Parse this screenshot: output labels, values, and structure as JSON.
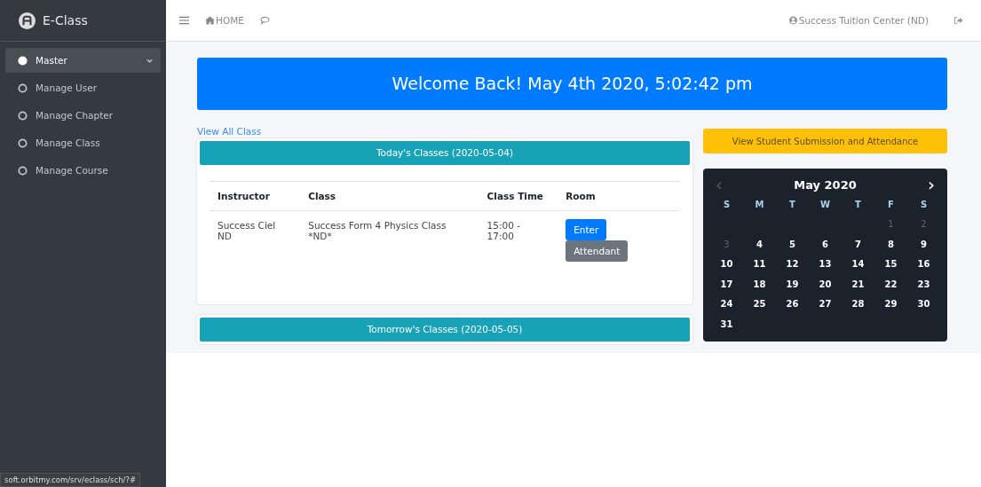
{
  "brand": {
    "name": "E-Class"
  },
  "sidebar": {
    "items": [
      {
        "kind": "group",
        "label": "Master",
        "selected": true,
        "expanded": true
      },
      {
        "kind": "link",
        "label": "Manage User",
        "selected": false
      },
      {
        "kind": "link",
        "label": "Manage Chapter",
        "selected": false
      },
      {
        "kind": "link",
        "label": "Manage Class",
        "selected": false
      },
      {
        "kind": "link",
        "label": "Manage Course",
        "selected": false
      }
    ]
  },
  "navbar": {
    "home": "HOME",
    "user": "Success Tuition Center (ND)"
  },
  "banner": {
    "text": "Welcome Back!  May 4th 2020, 5:02:42 pm"
  },
  "view_all_link": "View All Class",
  "today": {
    "title": "Today's Classes (2020-05-04)",
    "columns": [
      "Instructor",
      "Class",
      "Class Time",
      "Room"
    ],
    "rows": [
      {
        "instructor": "Success Ciel ND",
        "class": "Success Form 4 Physics Class *ND*",
        "time": "15:00 - 17:00",
        "buttons": [
          {
            "kind": "primary",
            "label": "Enter"
          },
          {
            "kind": "secondary",
            "label": "Attendant"
          }
        ]
      }
    ]
  },
  "tomorrow": {
    "title": "Tomorrow's Classes (2020-05-05)"
  },
  "submission_button": "View Student Submission and Attendance",
  "calendar": {
    "title": "May 2020",
    "prev": {
      "label": "‹",
      "disabled": true
    },
    "next": {
      "label": "›",
      "disabled": false
    },
    "weekdays": [
      "S",
      "M",
      "T",
      "W",
      "T",
      "F",
      "S"
    ],
    "weeks": [
      [
        {
          "day": "1",
          "muted": true
        },
        {
          "day": "2",
          "muted": true
        }
      ],
      [
        {
          "day": "3",
          "muted": true
        },
        {
          "day": "4",
          "muted": false
        },
        {
          "day": "5",
          "muted": false
        },
        {
          "day": "6",
          "muted": false
        },
        {
          "day": "7",
          "muted": false
        },
        {
          "day": "8",
          "muted": false
        },
        {
          "day": "9",
          "muted": false
        }
      ],
      [
        {
          "day": "10",
          "muted": false
        },
        {
          "day": "11",
          "muted": false
        },
        {
          "day": "12",
          "muted": false
        },
        {
          "day": "13",
          "muted": false
        },
        {
          "day": "14",
          "muted": false
        },
        {
          "day": "15",
          "muted": false
        },
        {
          "day": "16",
          "muted": false
        }
      ],
      [
        {
          "day": "17",
          "muted": false
        },
        {
          "day": "18",
          "muted": false
        },
        {
          "day": "19",
          "muted": false
        },
        {
          "day": "20",
          "muted": false
        },
        {
          "day": "21",
          "muted": false
        },
        {
          "day": "22",
          "muted": false
        },
        {
          "day": "23",
          "muted": false
        }
      ],
      [
        {
          "day": "24",
          "muted": false
        },
        {
          "day": "25",
          "muted": false
        },
        {
          "day": "26",
          "muted": false
        },
        {
          "day": "27",
          "muted": false
        },
        {
          "day": "28",
          "muted": false
        },
        {
          "day": "29",
          "muted": false
        },
        {
          "day": "30",
          "muted": false
        }
      ],
      [
        {
          "day": "31",
          "muted": false
        }
      ]
    ]
  },
  "status_url": "soft.orbitmy.com/srv/eclass/sch/?#"
}
